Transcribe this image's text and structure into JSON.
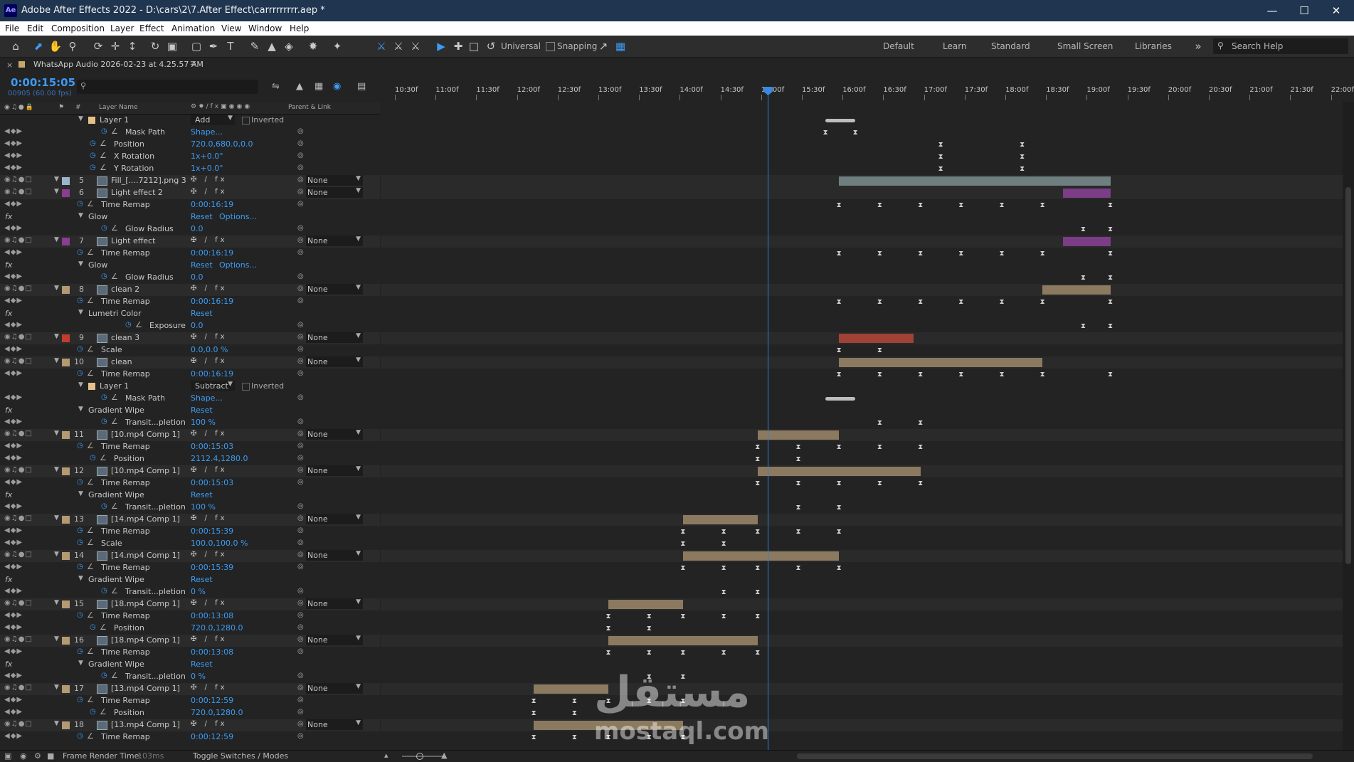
{
  "window": {
    "app_icon": "Ae",
    "title": "Adobe After Effects 2022 - D:\\cars\\2\\7.After Effect\\carrrrrrrrr.aep *",
    "controls": [
      "minimize-icon",
      "maximize-icon",
      "close-icon"
    ]
  },
  "menu": [
    "File",
    "Edit",
    "Composition",
    "Layer",
    "Effect",
    "Animation",
    "View",
    "Window",
    "Help"
  ],
  "toolbar": {
    "universal_label": "Universal",
    "snapping_label": "Snapping",
    "workspaces": [
      "Default",
      "Learn",
      "Standard",
      "Small Screen",
      "Libraries"
    ],
    "search_placeholder": "Search Help"
  },
  "panel": {
    "tab_title": "WhatsApp Audio 2026-02-23 at 4.25.57 AM",
    "timecode": "0:00:15:05",
    "frames": "00905 (60.00 fps)",
    "columns": {
      "layer_name": "Layer Name",
      "parent": "Parent & Link",
      "hash": "#"
    }
  },
  "ruler_ticks": [
    "10:30f",
    "11:00f",
    "11:30f",
    "12:00f",
    "12:30f",
    "13:00f",
    "13:30f",
    "14:00f",
    "14:30f",
    "15:00f",
    "15:30f",
    "16:00f",
    "16:30f",
    "17:00f",
    "17:30f",
    "18:00f",
    "18:30f",
    "19:00f",
    "19:30f",
    "20:00f",
    "20:30f",
    "21:00f",
    "21:30f",
    "22:00f"
  ],
  "rows": [
    {
      "kind": "mask",
      "indent": 140,
      "name": "Layer 1",
      "mode": "Add",
      "inverted": "Inverted"
    },
    {
      "kind": "prop",
      "indent": 176,
      "name": "Mask Path",
      "value": "Shape..."
    },
    {
      "kind": "prop",
      "indent": 160,
      "name": "Position",
      "value": "720.0,680.0,0.0"
    },
    {
      "kind": "prop",
      "indent": 160,
      "name": "X Rotation",
      "value": "1x+0.0°"
    },
    {
      "kind": "prop",
      "indent": 160,
      "name": "Y Rotation",
      "value": "1x+0.0°"
    },
    {
      "kind": "layer",
      "num": "5",
      "name": "Fill_[....7212].png 3",
      "label": "#9bb6c8",
      "parent": "None"
    },
    {
      "kind": "layer",
      "num": "6",
      "name": "Light effect 2",
      "label": "#8a3e8f",
      "parent": "None"
    },
    {
      "kind": "prop",
      "indent": 142,
      "name": "Time Remap",
      "value": "0:00:16:19"
    },
    {
      "kind": "effect",
      "indent": 124,
      "name": "Glow",
      "value": "Reset",
      "opt": "Options..."
    },
    {
      "kind": "prop",
      "indent": 176,
      "name": "Glow Radius",
      "value": "0.0"
    },
    {
      "kind": "layer",
      "num": "7",
      "name": "Light effect",
      "label": "#8a3e8f",
      "parent": "None"
    },
    {
      "kind": "prop",
      "indent": 142,
      "name": "Time Remap",
      "value": "0:00:16:19"
    },
    {
      "kind": "effect",
      "indent": 124,
      "name": "Glow",
      "value": "Reset",
      "opt": "Options..."
    },
    {
      "kind": "prop",
      "indent": 176,
      "name": "Glow Radius",
      "value": "0.0"
    },
    {
      "kind": "layer",
      "num": "8",
      "name": "clean 2",
      "label": "#b49a72",
      "parent": "None"
    },
    {
      "kind": "prop",
      "indent": 142,
      "name": "Time Remap",
      "value": "0:00:16:19"
    },
    {
      "kind": "effect",
      "indent": 124,
      "name": "Lumetri Color",
      "value": "Reset",
      "opt": ""
    },
    {
      "kind": "prop",
      "indent": 210,
      "name": "Exposure",
      "value": "0.0"
    },
    {
      "kind": "layer",
      "num": "9",
      "name": "clean 3",
      "label": "#c43c2e",
      "parent": "None"
    },
    {
      "kind": "prop",
      "indent": 142,
      "name": "Scale",
      "value": "0.0,0.0 %"
    },
    {
      "kind": "layer",
      "num": "10",
      "name": "clean",
      "label": "#b49a72",
      "parent": "None"
    },
    {
      "kind": "prop",
      "indent": 142,
      "name": "Time Remap",
      "value": "0:00:16:19"
    },
    {
      "kind": "mask",
      "indent": 140,
      "name": "Layer 1",
      "mode": "Subtract",
      "inverted": "Inverted"
    },
    {
      "kind": "prop",
      "indent": 176,
      "name": "Mask Path",
      "value": "Shape..."
    },
    {
      "kind": "effect",
      "indent": 124,
      "name": "Gradient Wipe",
      "value": "Reset",
      "opt": ""
    },
    {
      "kind": "prop",
      "indent": 176,
      "name": "Transit...pletion",
      "value": "100 %"
    },
    {
      "kind": "layer",
      "num": "11",
      "name": "[10.mp4 Comp 1]",
      "label": "#b49a72",
      "parent": "None"
    },
    {
      "kind": "prop",
      "indent": 142,
      "name": "Time Remap",
      "value": "0:00:15:03"
    },
    {
      "kind": "prop",
      "indent": 160,
      "name": "Position",
      "value": "2112.4,1280.0"
    },
    {
      "kind": "layer",
      "num": "12",
      "name": "[10.mp4 Comp 1]",
      "label": "#b49a72",
      "parent": "None"
    },
    {
      "kind": "prop",
      "indent": 142,
      "name": "Time Remap",
      "value": "0:00:15:03"
    },
    {
      "kind": "effect",
      "indent": 124,
      "name": "Gradient Wipe",
      "value": "Reset",
      "opt": ""
    },
    {
      "kind": "prop",
      "indent": 176,
      "name": "Transit...pletion",
      "value": "100 %"
    },
    {
      "kind": "layer",
      "num": "13",
      "name": "[14.mp4 Comp 1]",
      "label": "#b49a72",
      "parent": "None"
    },
    {
      "kind": "prop",
      "indent": 142,
      "name": "Time Remap",
      "value": "0:00:15:39"
    },
    {
      "kind": "prop",
      "indent": 142,
      "name": "Scale",
      "value": "100.0,100.0 %"
    },
    {
      "kind": "layer",
      "num": "14",
      "name": "[14.mp4 Comp 1]",
      "label": "#b49a72",
      "parent": "None"
    },
    {
      "kind": "prop",
      "indent": 142,
      "name": "Time Remap",
      "value": "0:00:15:39"
    },
    {
      "kind": "effect",
      "indent": 124,
      "name": "Gradient Wipe",
      "value": "Reset",
      "opt": ""
    },
    {
      "kind": "prop",
      "indent": 176,
      "name": "Transit...pletion",
      "value": "0 %"
    },
    {
      "kind": "layer",
      "num": "15",
      "name": "[18.mp4 Comp 1]",
      "label": "#b49a72",
      "parent": "None"
    },
    {
      "kind": "prop",
      "indent": 142,
      "name": "Time Remap",
      "value": "0:00:13:08"
    },
    {
      "kind": "prop",
      "indent": 160,
      "name": "Position",
      "value": "720.0,1280.0"
    },
    {
      "kind": "layer",
      "num": "16",
      "name": "[18.mp4 Comp 1]",
      "label": "#b49a72",
      "parent": "None"
    },
    {
      "kind": "prop",
      "indent": 142,
      "name": "Time Remap",
      "value": "0:00:13:08"
    },
    {
      "kind": "effect",
      "indent": 124,
      "name": "Gradient Wipe",
      "value": "Reset",
      "opt": ""
    },
    {
      "kind": "prop",
      "indent": 176,
      "name": "Transit...pletion",
      "value": "0 %"
    },
    {
      "kind": "layer",
      "num": "17",
      "name": "[13.mp4 Comp 1]",
      "label": "#b49a72",
      "parent": "None"
    },
    {
      "kind": "prop",
      "indent": 142,
      "name": "Time Remap",
      "value": "0:00:12:59"
    },
    {
      "kind": "prop",
      "indent": 160,
      "name": "Position",
      "value": "720.0,1280.0"
    },
    {
      "kind": "layer",
      "num": "18",
      "name": "[13.mp4 Comp 1]",
      "label": "#b49a72",
      "parent": "None"
    },
    {
      "kind": "prop",
      "indent": 142,
      "name": "Time Remap",
      "value": "0:00:12:59"
    }
  ],
  "tracks": [
    {
      "bars": [
        {
          "from": "15:50",
          "to": "16:12",
          "type": "mask"
        }
      ],
      "keys": []
    },
    {
      "bars": [],
      "keys": [
        "15:50",
        "16:12"
      ]
    },
    {
      "bars": [],
      "keys": [
        "17:15",
        "18:15"
      ]
    },
    {
      "bars": [],
      "keys": [
        "17:15",
        "18:15"
      ]
    },
    {
      "bars": [],
      "keys": [
        "17:15",
        "18:15"
      ]
    },
    {
      "bars": [
        {
          "from": "16:00",
          "to": "19:20",
          "color": "#6f7f7f"
        }
      ],
      "keys": []
    },
    {
      "bars": [
        {
          "from": "18:45",
          "to": "19:20",
          "color": "#7a3d86"
        }
      ],
      "keys": []
    },
    {
      "bars": [],
      "keys": [
        "16:00",
        "16:30",
        "17:00",
        "17:30",
        "18:00",
        "18:30",
        "19:20"
      ]
    },
    {
      "bars": [],
      "keys": []
    },
    {
      "bars": [],
      "keys": [
        "19:00",
        "19:20"
      ]
    },
    {
      "bars": [
        {
          "from": "18:45",
          "to": "19:20",
          "color": "#7a3d86"
        }
      ],
      "keys": []
    },
    {
      "bars": [],
      "keys": [
        "16:00",
        "16:30",
        "17:00",
        "17:30",
        "18:00",
        "18:30",
        "19:20"
      ]
    },
    {
      "bars": [],
      "keys": []
    },
    {
      "bars": [],
      "keys": [
        "19:00",
        "19:20"
      ]
    },
    {
      "bars": [
        {
          "from": "18:30",
          "to": "19:20",
          "color": "#8c7a60"
        }
      ],
      "keys": []
    },
    {
      "bars": [],
      "keys": [
        "16:00",
        "16:30",
        "17:00",
        "17:30",
        "18:00",
        "18:30",
        "19:20"
      ]
    },
    {
      "bars": [],
      "keys": []
    },
    {
      "bars": [],
      "keys": [
        "19:00",
        "19:20"
      ]
    },
    {
      "bars": [
        {
          "from": "16:00",
          "to": "16:55",
          "color": "#a14237"
        }
      ],
      "keys": []
    },
    {
      "bars": [],
      "keys": [
        "16:00",
        "16:30"
      ]
    },
    {
      "bars": [
        {
          "from": "16:00",
          "to": "18:30",
          "color": "#8c7a60"
        }
      ],
      "keys": []
    },
    {
      "bars": [],
      "keys": [
        "16:00",
        "16:30",
        "17:00",
        "17:30",
        "18:00",
        "18:30",
        "19:20"
      ]
    },
    {
      "bars": [],
      "keys": []
    },
    {
      "bars": [
        {
          "from": "15:50",
          "to": "16:12",
          "type": "mask"
        }
      ],
      "keys": []
    },
    {
      "bars": [],
      "keys": []
    },
    {
      "bars": [],
      "keys": [
        "16:30",
        "17:00"
      ]
    },
    {
      "bars": [
        {
          "from": "15:00",
          "to": "16:00",
          "color": "#8c7a60"
        }
      ],
      "keys": []
    },
    {
      "bars": [],
      "keys": [
        "15:00",
        "15:30",
        "16:00",
        "16:30",
        "17:00"
      ]
    },
    {
      "bars": [],
      "keys": [
        "15:00",
        "15:30"
      ]
    },
    {
      "bars": [
        {
          "from": "15:00",
          "to": "17:00",
          "color": "#8c7a60"
        }
      ],
      "keys": []
    },
    {
      "bars": [],
      "keys": [
        "15:00",
        "15:30",
        "16:00",
        "16:30",
        "17:00"
      ]
    },
    {
      "bars": [],
      "keys": []
    },
    {
      "bars": [],
      "keys": [
        "15:30",
        "16:00"
      ]
    },
    {
      "bars": [
        {
          "from": "14:05",
          "to": "15:00",
          "color": "#8c7a60"
        }
      ],
      "keys": []
    },
    {
      "bars": [],
      "keys": [
        "14:05",
        "14:35",
        "15:00",
        "15:30",
        "16:00"
      ]
    },
    {
      "bars": [],
      "keys": [
        "14:05",
        "14:35"
      ]
    },
    {
      "bars": [
        {
          "from": "14:05",
          "to": "16:00",
          "color": "#8c7a60"
        }
      ],
      "keys": []
    },
    {
      "bars": [],
      "keys": [
        "14:05",
        "14:35",
        "15:00",
        "15:30",
        "16:00"
      ]
    },
    {
      "bars": [],
      "keys": []
    },
    {
      "bars": [],
      "keys": [
        "14:35",
        "15:00"
      ]
    },
    {
      "bars": [
        {
          "from": "13:10",
          "to": "14:05",
          "color": "#8c7a60"
        }
      ],
      "keys": []
    },
    {
      "bars": [],
      "keys": [
        "13:10",
        "13:40",
        "14:05",
        "14:35",
        "15:00"
      ]
    },
    {
      "bars": [],
      "keys": [
        "13:10",
        "13:40"
      ]
    },
    {
      "bars": [
        {
          "from": "13:10",
          "to": "15:00",
          "color": "#8c7a60"
        }
      ],
      "keys": []
    },
    {
      "bars": [],
      "keys": [
        "13:10",
        "13:40",
        "14:05",
        "14:35",
        "15:00"
      ]
    },
    {
      "bars": [],
      "keys": []
    },
    {
      "bars": [],
      "keys": [
        "13:40",
        "14:05"
      ]
    },
    {
      "bars": [
        {
          "from": "12:15",
          "to": "13:10",
          "color": "#8c7a60"
        }
      ],
      "keys": []
    },
    {
      "bars": [],
      "keys": [
        "12:15",
        "12:45",
        "13:10",
        "13:40",
        "14:05"
      ]
    },
    {
      "bars": [],
      "keys": [
        "12:15",
        "12:45"
      ]
    },
    {
      "bars": [
        {
          "from": "12:15",
          "to": "14:05",
          "color": "#8c7a60"
        }
      ],
      "keys": []
    },
    {
      "bars": [],
      "keys": [
        "12:15",
        "12:45",
        "13:10",
        "13:40",
        "14:05"
      ]
    }
  ],
  "status": {
    "render_label": "Frame Render Time:",
    "render_value": "103ms",
    "toggle": "Toggle Switches / Modes"
  },
  "watermark": {
    "arabic": "مستقل",
    "latin": "mostaql.com"
  }
}
